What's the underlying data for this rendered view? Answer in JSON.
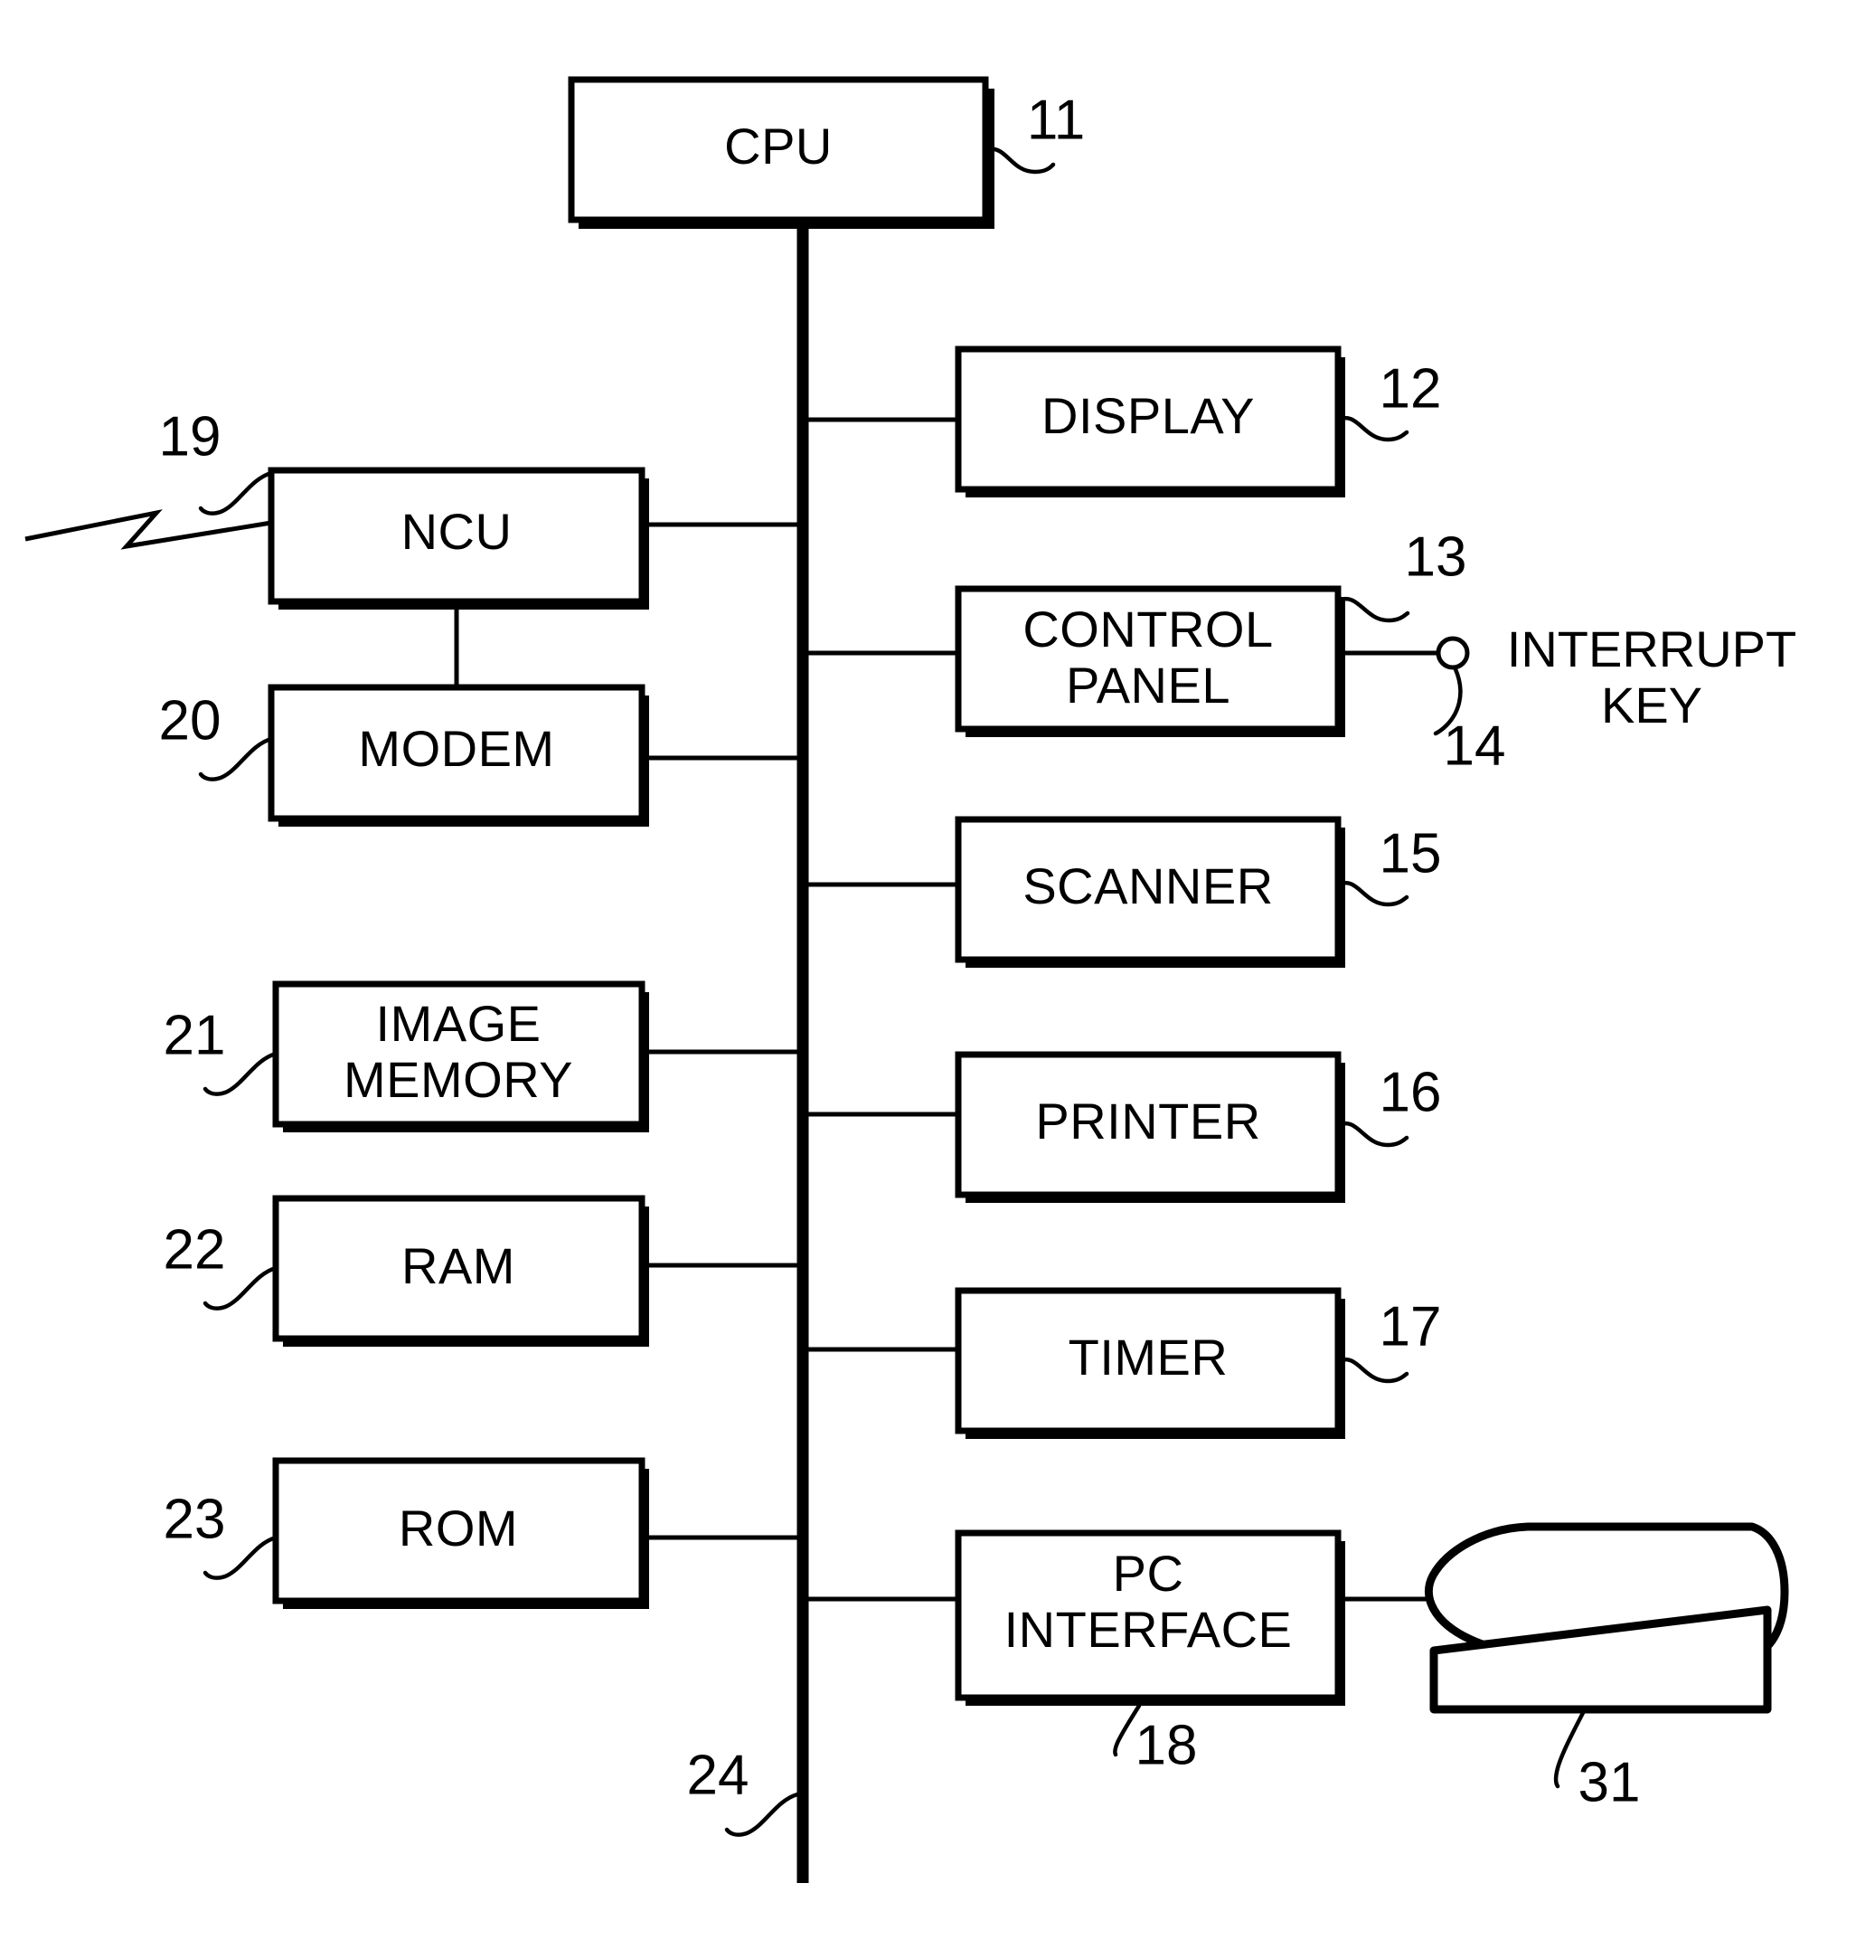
{
  "figure": {
    "type": "patent-block-diagram",
    "description": "Facsimile apparatus block diagram with CPU and system bus"
  },
  "blocks": [
    {
      "id": "cpu",
      "label": "CPU",
      "ref": "11"
    },
    {
      "id": "display",
      "label": "DISPLAY",
      "ref": "12"
    },
    {
      "id": "control_panel",
      "label": "CONTROL PANEL",
      "line1": "CONTROL",
      "line2": "PANEL",
      "ref": "13"
    },
    {
      "id": "scanner",
      "label": "SCANNER",
      "ref": "15"
    },
    {
      "id": "printer",
      "label": "PRINTER",
      "ref": "16"
    },
    {
      "id": "timer",
      "label": "TIMER",
      "ref": "17"
    },
    {
      "id": "pc_interface",
      "label": "PC INTERFACE",
      "line1": "PC",
      "line2": "INTERFACE",
      "ref": "18"
    },
    {
      "id": "ncu",
      "label": "NCU",
      "ref": "19"
    },
    {
      "id": "modem",
      "label": "MODEM",
      "ref": "20"
    },
    {
      "id": "image_memory",
      "label": "IMAGE MEMORY",
      "line1": "IMAGE",
      "line2": "MEMORY",
      "ref": "21"
    },
    {
      "id": "ram",
      "label": "RAM",
      "ref": "22"
    },
    {
      "id": "rom",
      "label": "ROM",
      "ref": "23"
    }
  ],
  "external": {
    "interrupt_key": {
      "line1": "INTERRUPT",
      "line2": "KEY",
      "ref": "14"
    },
    "personal_computer": {
      "ref": "31"
    },
    "bus": {
      "ref": "24"
    }
  },
  "colors": {
    "line": "#000000",
    "background": "#ffffff",
    "fill": "#ffffff"
  }
}
